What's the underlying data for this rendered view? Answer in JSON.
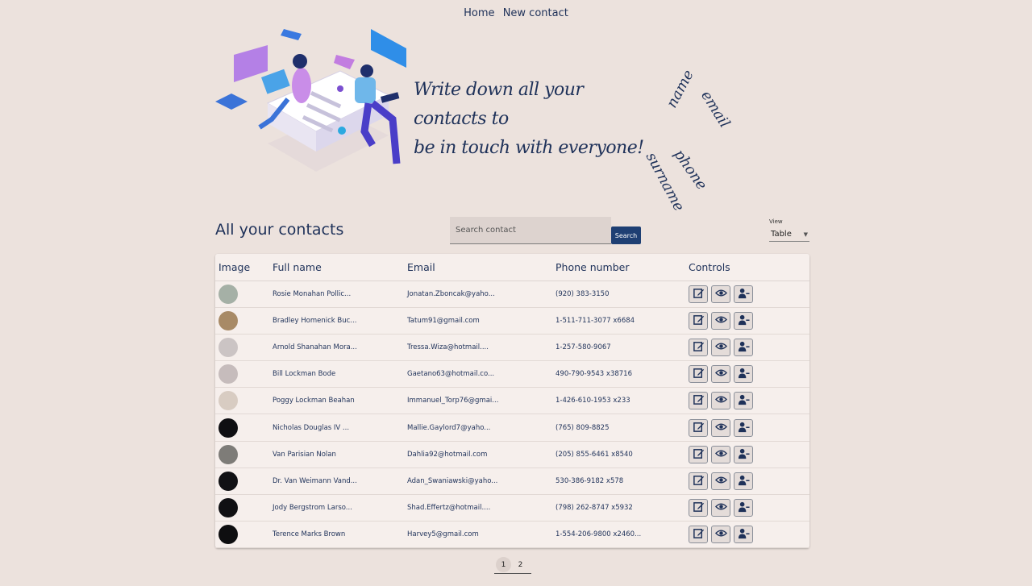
{
  "nav": {
    "home": "Home",
    "new_contact": "New contact"
  },
  "hero": {
    "tagline_line1": "Write down all your contacts to",
    "tagline_line2": "be in touch with everyone!",
    "words": {
      "name": "name",
      "email": "email",
      "phone": "phone",
      "surname": "surname"
    }
  },
  "contacts_title": "All your contacts",
  "search": {
    "placeholder": "Search contact",
    "button": "Search"
  },
  "view": {
    "label": "View",
    "selected": "Table"
  },
  "table": {
    "headers": {
      "image": "Image",
      "full_name": "Full name",
      "email": "Email",
      "phone": "Phone number",
      "controls": "Controls"
    },
    "rows": [
      {
        "name": "Rosie Monahan Pollic...",
        "email": "Jonatan.Zboncak@yaho...",
        "phone": "(920) 383-3150",
        "avatar_color": "#a5b0a6"
      },
      {
        "name": "Bradley Homenick Buc...",
        "email": "Tatum91@gmail.com",
        "phone": "1-511-711-3077 x6684",
        "avatar_color": "#a88a66"
      },
      {
        "name": "Arnold Shanahan Mora...",
        "email": "Tressa.Wiza@hotmail....",
        "phone": "1-257-580-9067",
        "avatar_color": "#cbc4c4"
      },
      {
        "name": "Bill Lockman Bode",
        "email": "Gaetano63@hotmail.co...",
        "phone": "490-790-9543 x38716",
        "avatar_color": "#c6bcbc"
      },
      {
        "name": "Poggy Lockman Beahan",
        "email": "Immanuel_Torp76@gmai...",
        "phone": "1-426-610-1953 x233",
        "avatar_color": "#d8ccc2"
      },
      {
        "name": "Nicholas Douglas IV ...",
        "email": "Mallie.Gaylord7@yaho...",
        "phone": "(765) 809-8825",
        "avatar_color": "#0f0f12"
      },
      {
        "name": "Van Parisian Nolan",
        "email": "Dahlia92@hotmail.com",
        "phone": "(205) 855-6461 x8540",
        "avatar_color": "#7e7c78"
      },
      {
        "name": "Dr. Van Weimann Vand...",
        "email": "Adan_Swaniawski@yaho...",
        "phone": "530-386-9182 x578",
        "avatar_color": "#111114"
      },
      {
        "name": "Jody Bergstrom Larso...",
        "email": "Shad.Effertz@hotmail....",
        "phone": "(798) 262-8747 x5932",
        "avatar_color": "#101013"
      },
      {
        "name": "Terence Marks Brown",
        "email": "Harvey5@gmail.com",
        "phone": "1-554-206-9800 x2460...",
        "avatar_color": "#0e0e10"
      }
    ]
  },
  "pagination": {
    "pages": [
      "1",
      "2"
    ],
    "current": "1"
  },
  "colors": {
    "background": "#ece2dd",
    "navy": "#1e3159",
    "search_button": "#1e3f73",
    "card": "#f6efec"
  }
}
